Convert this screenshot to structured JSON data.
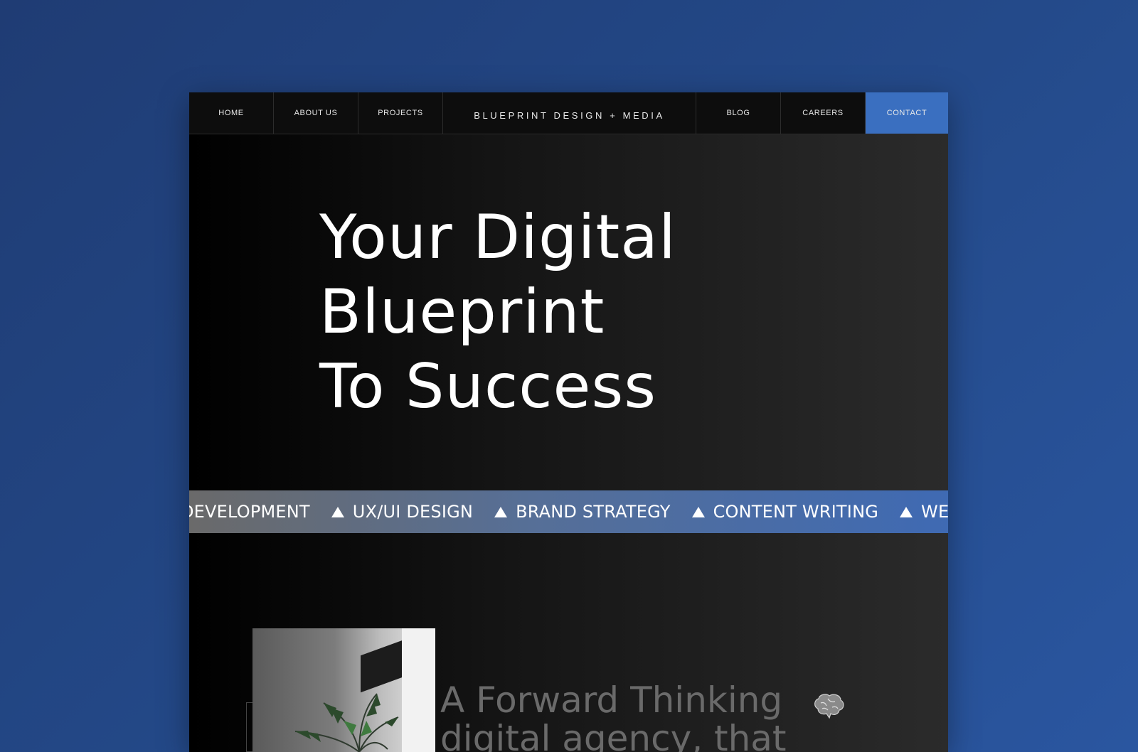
{
  "nav": {
    "items_left": [
      "HOME",
      "ABOUT US",
      "PROJECTS"
    ],
    "brand": "BLUEPRINT DESIGN + MEDIA",
    "items_right": [
      "BLOG",
      "CAREERS",
      "CONTACT"
    ]
  },
  "hero": {
    "line1": "Your Digital",
    "line2": "Blueprint",
    "line3": "To Success"
  },
  "ticker": {
    "items": [
      "DEVELOPMENT",
      "UX/UI DESIGN",
      "BRAND STRATEGY",
      "CONTENT WRITING",
      "WEB DE"
    ]
  },
  "intro": {
    "line1": "A Forward Thinking",
    "line2": "digital agency, that"
  },
  "colors": {
    "background": "#244a8a",
    "contact_accent": "#3a6fc0"
  },
  "icons": [
    "triangle-icon",
    "brain-icon"
  ]
}
